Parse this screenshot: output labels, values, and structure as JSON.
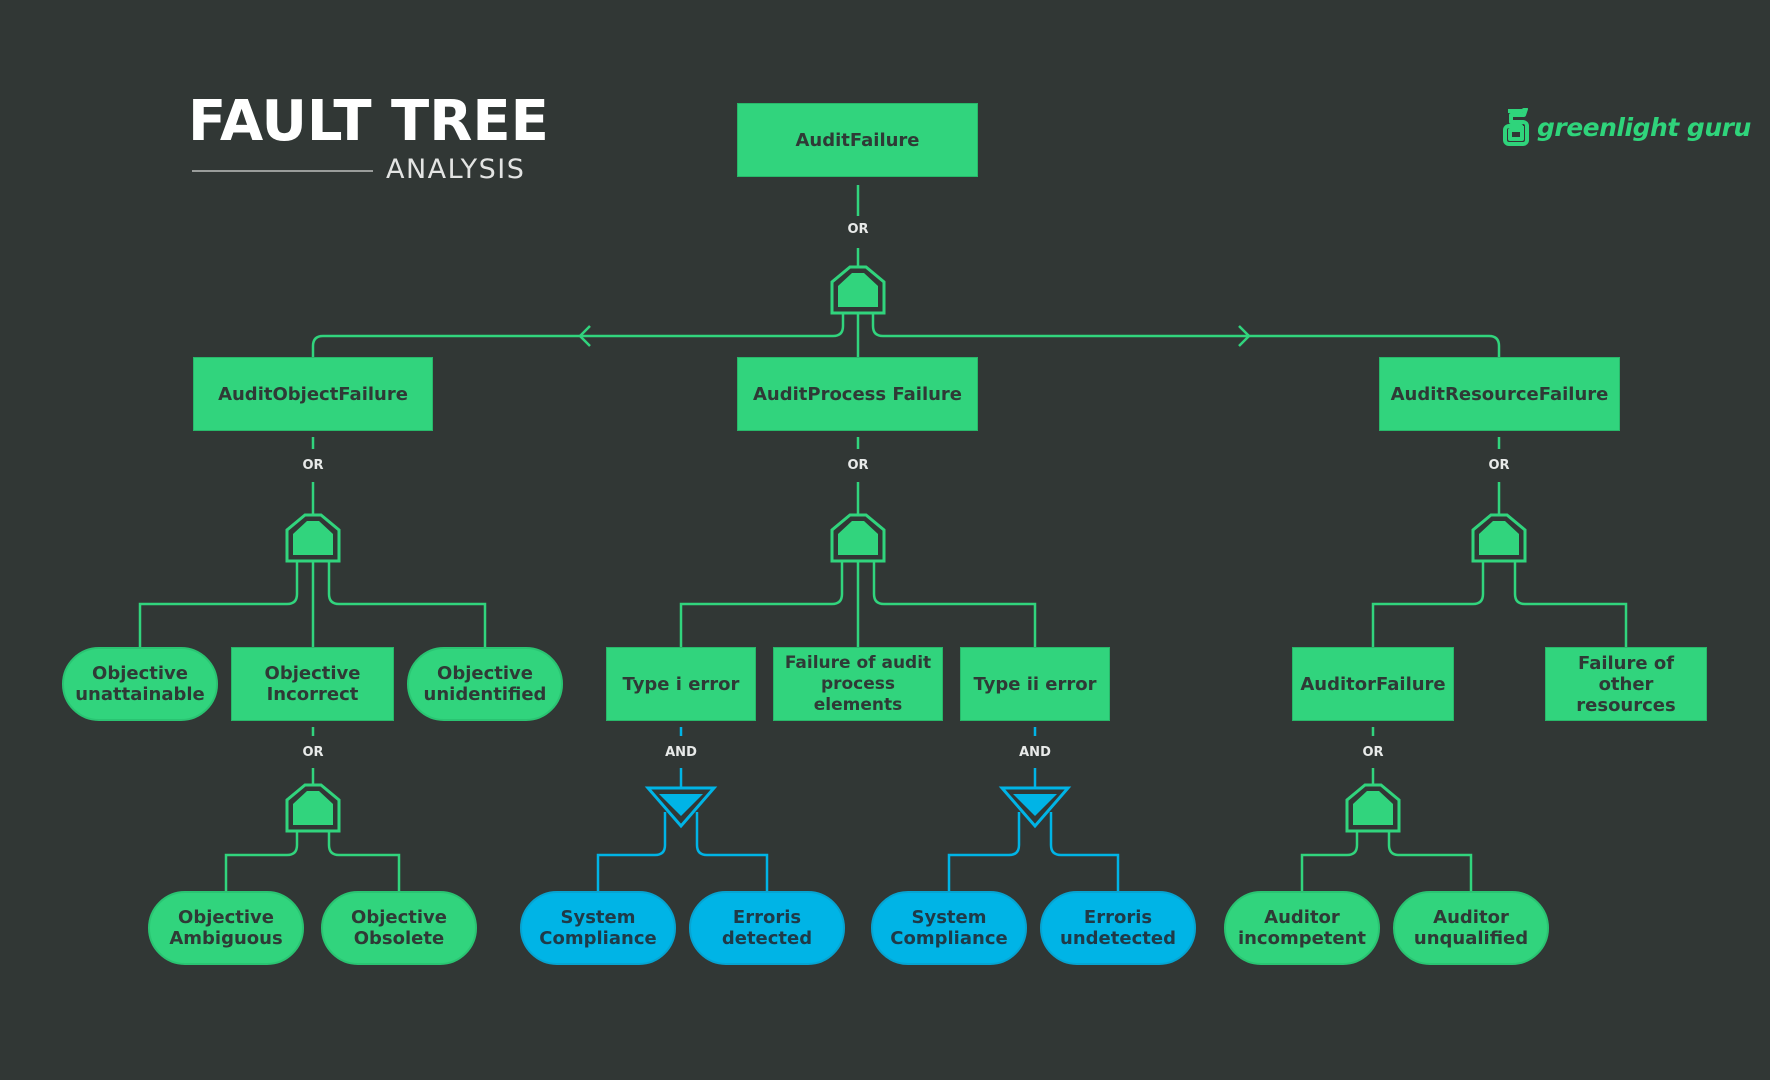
{
  "title": {
    "main": "FAULT TREE",
    "sub": "ANALYSIS"
  },
  "brand": {
    "name": "greenlight guru",
    "icon": "greenlight-g-logo-icon"
  },
  "colors": {
    "background": "#313735",
    "green": "#31d47d",
    "blue": "#00b4e6",
    "text_dark": "#2f3a36",
    "gate_label": "#e8eae9"
  },
  "gate_types": {
    "or": "OR",
    "and": "AND"
  },
  "nodes": {
    "audit_failure": {
      "label": "AuditFailure",
      "shape": "rectangle",
      "gate": "OR"
    },
    "audit_object_failure": {
      "label": "AuditObjectFailure",
      "shape": "rectangle",
      "gate": "OR"
    },
    "audit_process_failure": {
      "label": "AuditProcess Failure",
      "shape": "rectangle",
      "gate": "OR"
    },
    "audit_resource_failure": {
      "label": "AuditResourceFailure",
      "shape": "rectangle",
      "gate": "OR"
    },
    "objective_unattainable": {
      "label": "Objective\nunattainable",
      "shape": "pill"
    },
    "objective_incorrect": {
      "label": "Objective\nIncorrect",
      "shape": "rectangle",
      "gate": "OR"
    },
    "objective_unidentified": {
      "label": "Objective\nunidentified",
      "shape": "pill"
    },
    "type_i_error": {
      "label": "Type i error",
      "shape": "rectangle",
      "gate": "AND"
    },
    "failure_audit_process_elements": {
      "label": "Failure of audit\nprocess elements",
      "shape": "rectangle"
    },
    "type_ii_error": {
      "label": "Type ii error",
      "shape": "rectangle",
      "gate": "AND"
    },
    "auditor_failure": {
      "label": "AuditorFailure",
      "shape": "rectangle",
      "gate": "OR"
    },
    "failure_other_resources": {
      "label": "Failure of other\nresources",
      "shape": "rectangle"
    },
    "objective_ambiguous": {
      "label": "Objective\nAmbiguous",
      "shape": "pill"
    },
    "objective_obsolete": {
      "label": "Objective\nObsolete",
      "shape": "pill"
    },
    "system_compliance_1": {
      "label": "System\nCompliance",
      "shape": "pill",
      "color": "blue"
    },
    "error_detected": {
      "label": "Erroris\ndetected",
      "shape": "pill",
      "color": "blue"
    },
    "system_compliance_2": {
      "label": "System\nCompliance",
      "shape": "pill",
      "color": "blue"
    },
    "error_undetected": {
      "label": "Erroris\nundetected",
      "shape": "pill",
      "color": "blue"
    },
    "auditor_incompetent": {
      "label": "Auditor\nincompetent",
      "shape": "pill"
    },
    "auditor_unqualified": {
      "label": "Auditor\nunqualified",
      "shape": "pill"
    }
  },
  "edges": [
    [
      "audit_failure",
      "audit_object_failure"
    ],
    [
      "audit_failure",
      "audit_process_failure"
    ],
    [
      "audit_failure",
      "audit_resource_failure"
    ],
    [
      "audit_object_failure",
      "objective_unattainable"
    ],
    [
      "audit_object_failure",
      "objective_incorrect"
    ],
    [
      "audit_object_failure",
      "objective_unidentified"
    ],
    [
      "objective_incorrect",
      "objective_ambiguous"
    ],
    [
      "objective_incorrect",
      "objective_obsolete"
    ],
    [
      "audit_process_failure",
      "type_i_error"
    ],
    [
      "audit_process_failure",
      "failure_audit_process_elements"
    ],
    [
      "audit_process_failure",
      "type_ii_error"
    ],
    [
      "type_i_error",
      "system_compliance_1"
    ],
    [
      "type_i_error",
      "error_detected"
    ],
    [
      "type_ii_error",
      "system_compliance_2"
    ],
    [
      "type_ii_error",
      "error_undetected"
    ],
    [
      "audit_resource_failure",
      "auditor_failure"
    ],
    [
      "audit_resource_failure",
      "failure_other_resources"
    ],
    [
      "auditor_failure",
      "auditor_incompetent"
    ],
    [
      "auditor_failure",
      "auditor_unqualified"
    ]
  ]
}
